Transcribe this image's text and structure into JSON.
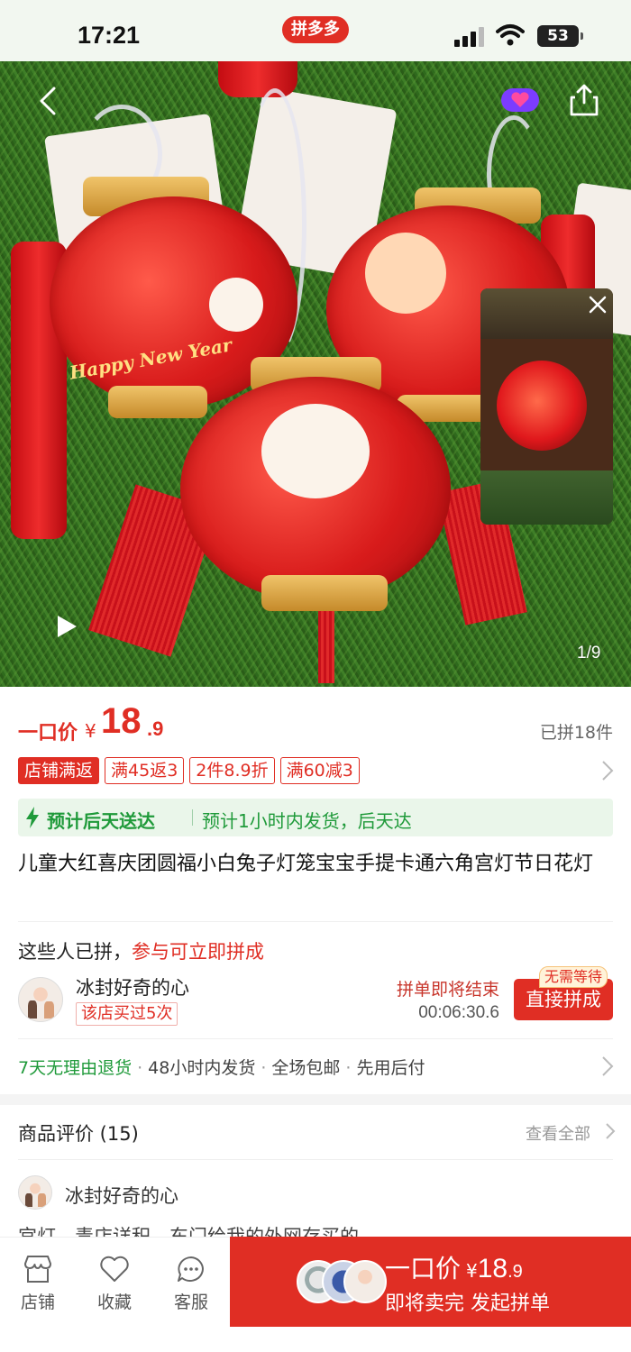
{
  "status_bar": {
    "time": "17:21",
    "app_badge": "拼多多",
    "battery": "53"
  },
  "hero": {
    "image_text": "Happy New Year",
    "page_indicator": "1/9"
  },
  "price": {
    "label": "一口价",
    "currency": "¥",
    "integer": "18",
    "decimal": ".9",
    "sold": "已拼18件"
  },
  "promos": [
    "店铺满返",
    "满45返3",
    "2件8.9折",
    "满60减3"
  ],
  "delivery": {
    "main": "预计后天送达",
    "sub": "预计1小时内发货，后天达"
  },
  "product_title": "儿童大红喜庆团圆福小白兔子灯笼宝宝手提卡通六角宫灯节日花灯",
  "group": {
    "heading_prefix": "这些人已拼，",
    "heading_highlight": "参与可立即拼成",
    "user_name": "冰封好奇的心",
    "badge": "该店买过5次",
    "ending_text": "拼单即将结束",
    "countdown": "00:06:30.6",
    "join_label": "直接拼成",
    "no_wait_badge": "无需等待"
  },
  "service": {
    "items": [
      "7天无理由退货",
      "48小时内发货",
      "全场包邮",
      "先用后付"
    ]
  },
  "reviews": {
    "title": "商品评价 (15)",
    "view_all": "查看全部",
    "user_name": "冰封好奇的心",
    "snippet": "宫灯，毒店详积，东门给我的外网存买的"
  },
  "bottom_nav": {
    "shop": "店铺",
    "favorite": "收藏",
    "service": "客服"
  },
  "buy_button": {
    "price_label": "一口价",
    "currency": "¥",
    "price_int": "18",
    "price_dec": ".9",
    "sub_label": "即将卖完 发起拼单"
  },
  "colors": {
    "brand_red": "#e02e24",
    "green": "#1f9a3a"
  }
}
